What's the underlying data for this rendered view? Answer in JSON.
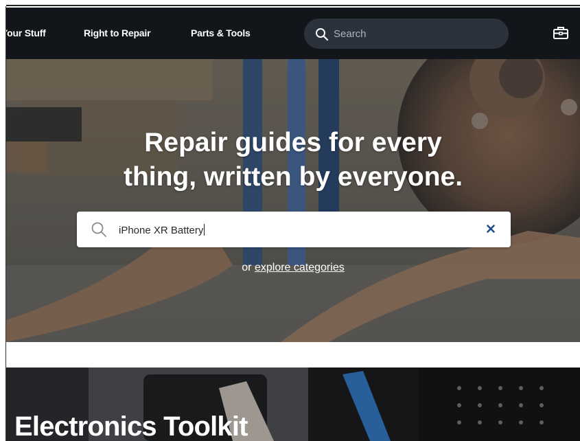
{
  "nav": {
    "links": [
      {
        "label": "Your Stuff"
      },
      {
        "label": "Right to Repair"
      },
      {
        "label": "Parts & Tools"
      }
    ],
    "search": {
      "placeholder": "Search"
    },
    "toolbox_icon": "toolbox-icon"
  },
  "hero": {
    "title_line1": "Repair guides for every",
    "title_line2": "thing, written by everyone.",
    "search": {
      "value": "iPhone XR Battery"
    },
    "explore_prefix": "or",
    "explore_link": "explore categories"
  },
  "toolkit": {
    "title": "Electronics Toolkit"
  },
  "colors": {
    "nav_bg": "#12161b",
    "nav_search_bg": "#2b323b",
    "clear_icon": "#1b4d8c"
  }
}
